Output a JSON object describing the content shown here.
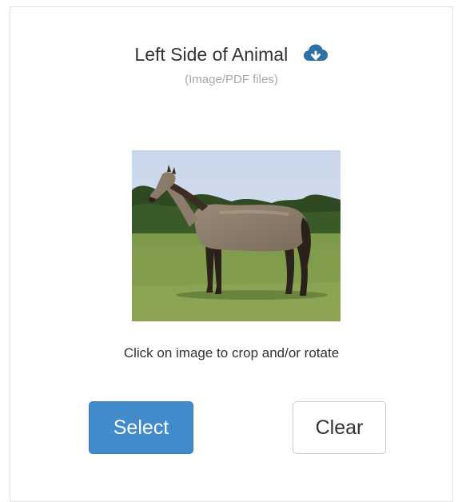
{
  "upload": {
    "title": "Left Side of Animal",
    "subtitle": "(Image/PDF files)",
    "title_icon": "cloud-upload-icon",
    "image_alt": "horse",
    "hint": "Click on image to crop and/or rotate"
  },
  "buttons": {
    "select_label": "Select",
    "clear_label": "Clear"
  },
  "colors": {
    "primary": "#428bca",
    "text": "#333333",
    "muted": "#a8a8a8",
    "border": "#e2e2e2"
  }
}
